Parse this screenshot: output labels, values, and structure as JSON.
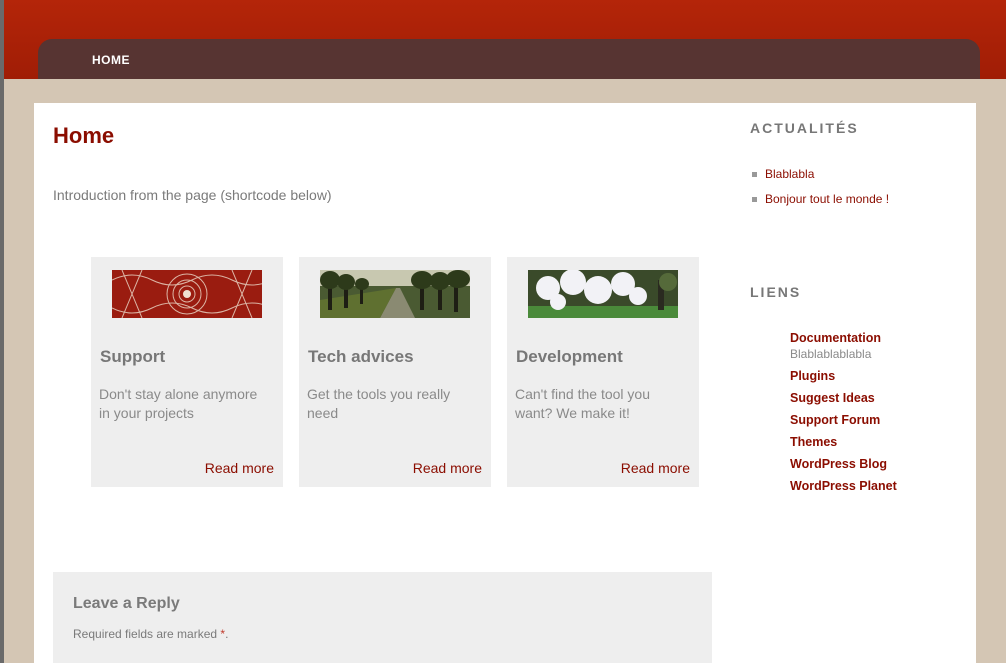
{
  "nav": {
    "home_label": "HOME"
  },
  "page": {
    "title": "Home",
    "intro": "Introduction from the page (shortcode below)"
  },
  "cards": [
    {
      "title": "Support",
      "text": "Don't stay alone anymore in your projects",
      "link": "Read more",
      "image": "red-lace-pattern"
    },
    {
      "title": "Tech advices",
      "text": "Get the tools you really need",
      "link": "Read more",
      "image": "tree-lined-path"
    },
    {
      "title": "Development",
      "text": "Can't find the tool you want? We make it!",
      "link": "Read more",
      "image": "white-blossom-tree"
    }
  ],
  "reply": {
    "title": "Leave a Reply",
    "required_text": "Required fields are marked",
    "required_mark": "*",
    "period": "."
  },
  "sidebar": {
    "news_title": "ACTUALITÉS",
    "news": [
      "Blablabla",
      "Bonjour tout le monde !"
    ],
    "links_title": "LIENS",
    "links": [
      {
        "label": "Documentation",
        "desc": "Blablablablabla"
      },
      {
        "label": "Plugins"
      },
      {
        "label": "Suggest Ideas"
      },
      {
        "label": "Support Forum"
      },
      {
        "label": "Themes"
      },
      {
        "label": "WordPress Blog"
      },
      {
        "label": "WordPress Planet"
      }
    ]
  },
  "colors": {
    "header": "#b42509",
    "nav": "#573432",
    "accent": "#8b0d00",
    "background": "#d4c6b4",
    "card": "#eeeeee"
  }
}
